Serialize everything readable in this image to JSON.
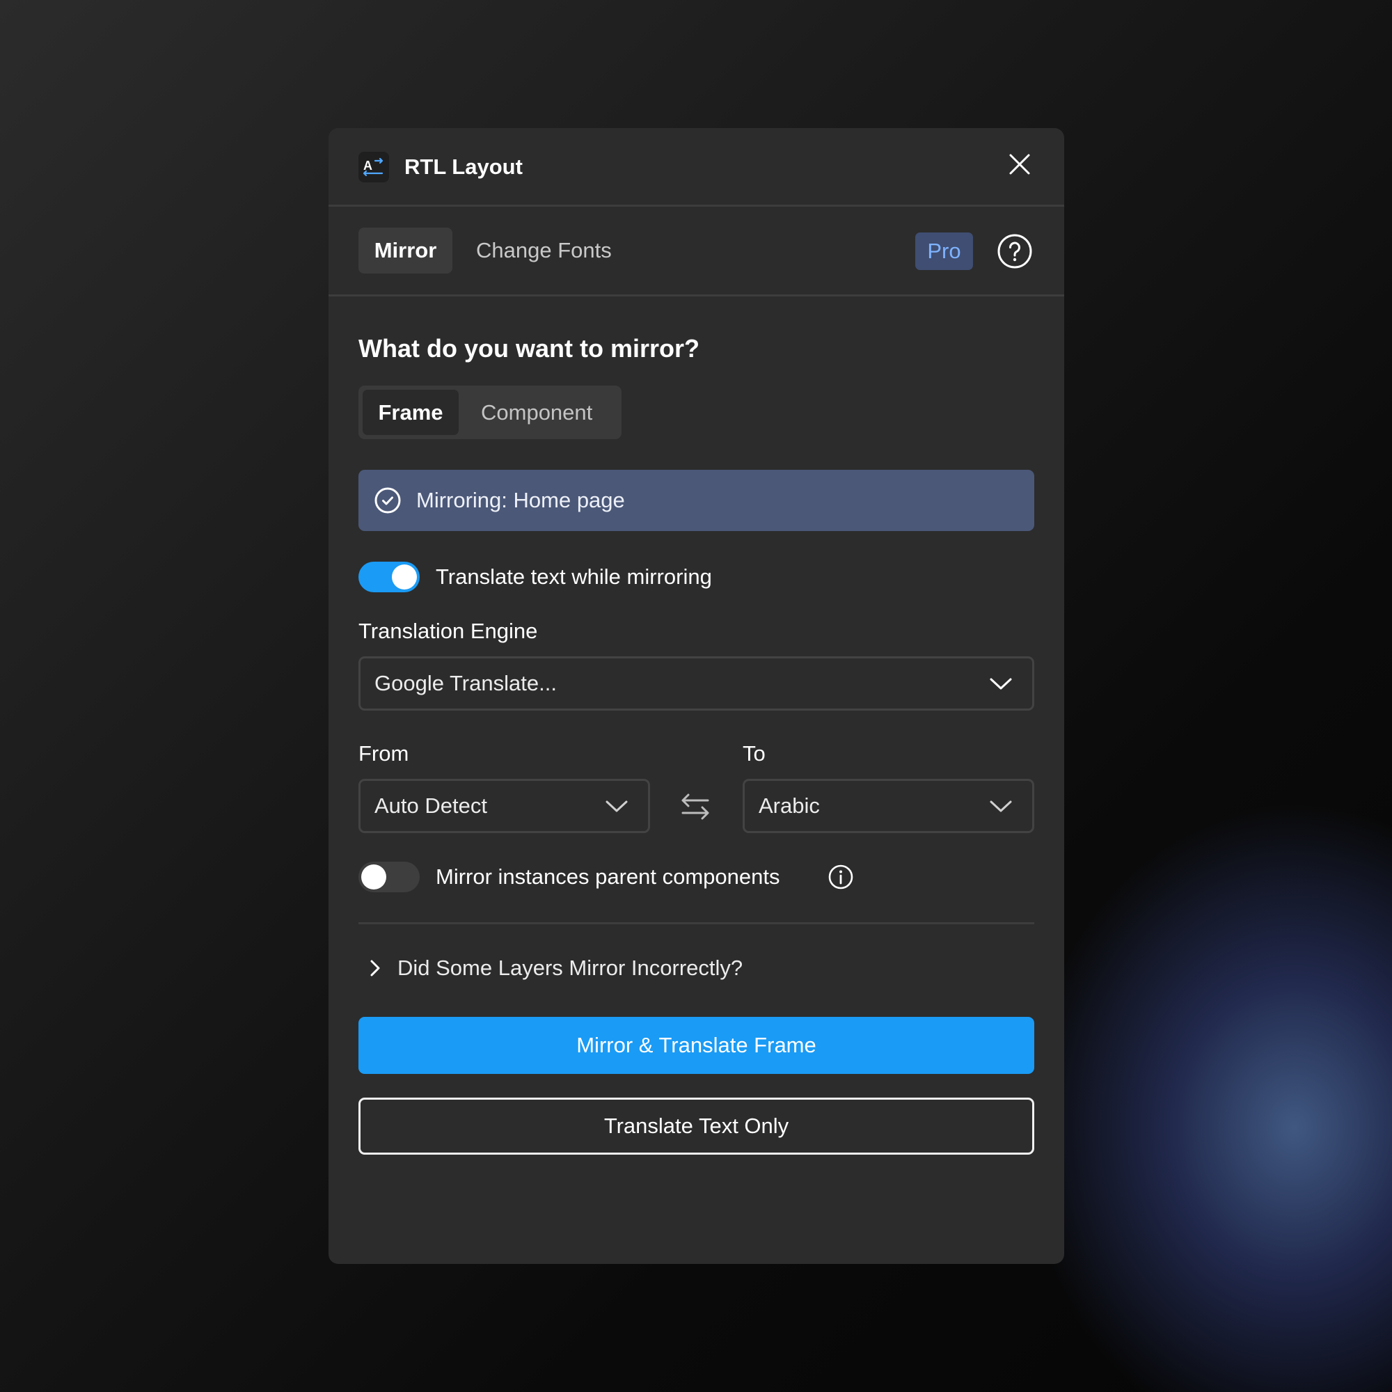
{
  "header": {
    "title": "RTL Layout",
    "logo_icon": "translate-icon",
    "close_icon": "close-icon"
  },
  "tabs": {
    "mirror": "Mirror",
    "change_fonts": "Change Fonts",
    "pro_badge": "Pro",
    "help_icon": "help-icon"
  },
  "mirror_section": {
    "question": "What do you want to mirror?",
    "segments": {
      "frame": "Frame",
      "component": "Component",
      "selected": "Frame"
    },
    "status": "Mirroring: Home page"
  },
  "translate": {
    "toggle_label": "Translate text while mirroring",
    "toggle_on": true,
    "engine_label": "Translation Engine",
    "engine_value": "Google Translate...",
    "from_label": "From",
    "from_value": "Auto Detect",
    "to_label": "To",
    "to_value": "Arabic"
  },
  "instances": {
    "toggle_label": "Mirror instances parent components",
    "toggle_on": false
  },
  "disclosure": "Did Some Layers Mirror Incorrectly?",
  "actions": {
    "primary": "Mirror & Translate Frame",
    "secondary": "Translate Text Only"
  },
  "colors": {
    "accent": "#1a9bf5",
    "status_bg": "#4b5878",
    "panel_bg": "#2c2c2c",
    "pro_text": "#7fb3ff"
  }
}
